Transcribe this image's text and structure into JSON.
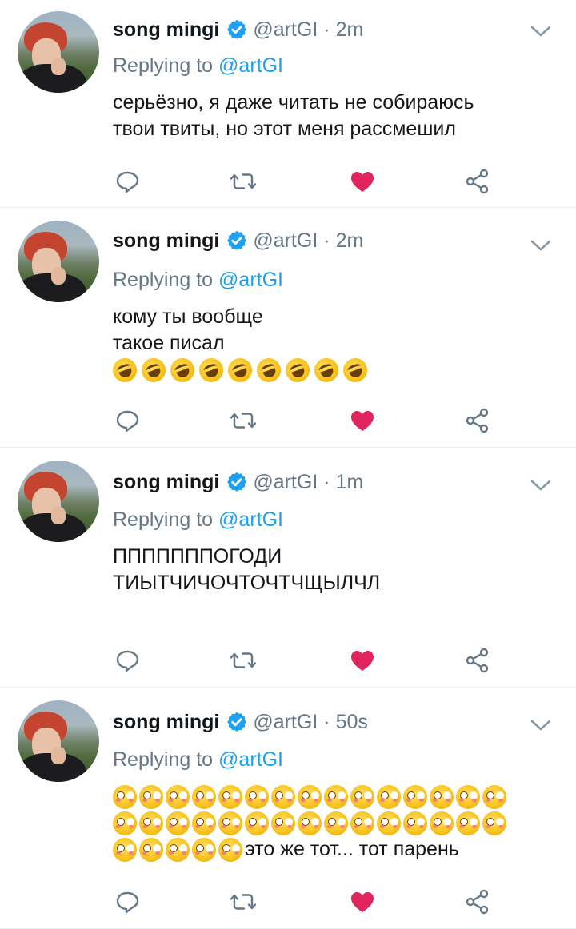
{
  "tweets": [
    {
      "name": "song mingi",
      "handle": "@artGI",
      "time": "2m",
      "replying_prefix": "Replying to",
      "replying_to": "@artGI",
      "lines": [
        "серьёзно, я даже читать не собираюсь",
        "твои твиты, но этот меня рассмешил"
      ]
    },
    {
      "name": "song mingi",
      "handle": "@artGI",
      "time": "2m",
      "replying_prefix": "Replying to",
      "replying_to": "@artGI",
      "lines": [
        "кому ты вообще",
        "такое писал"
      ],
      "emoji": "rolling-on-floor-laughing",
      "emoji_count": 9
    },
    {
      "name": "song mingi",
      "handle": "@artGI",
      "time": "1m",
      "replying_prefix": "Replying to",
      "replying_to": "@artGI",
      "lines": [
        "ПППППППОГОДИ",
        "ТИЫТЧИЧОЧТОЧТЧЩЫЛЧЛ"
      ]
    },
    {
      "name": "song mingi",
      "handle": "@artGI",
      "time": "50s",
      "replying_prefix": "Replying to",
      "replying_to": "@artGI",
      "emoji": "flushed-face",
      "emoji_rows": [
        15,
        15,
        5
      ],
      "trailing_text": "это же тот... тот парень"
    }
  ],
  "icons": {
    "verified": "verified-badge-icon",
    "more": "chevron-down-icon",
    "reply": "reply-bubble-icon",
    "retweet": "retweet-icon",
    "like": "heart-icon",
    "share": "share-icon"
  },
  "colors": {
    "accent": "#1da1f2",
    "liked": "#e0245e",
    "secondary_text": "#657786",
    "divider": "#e6ecf0"
  }
}
